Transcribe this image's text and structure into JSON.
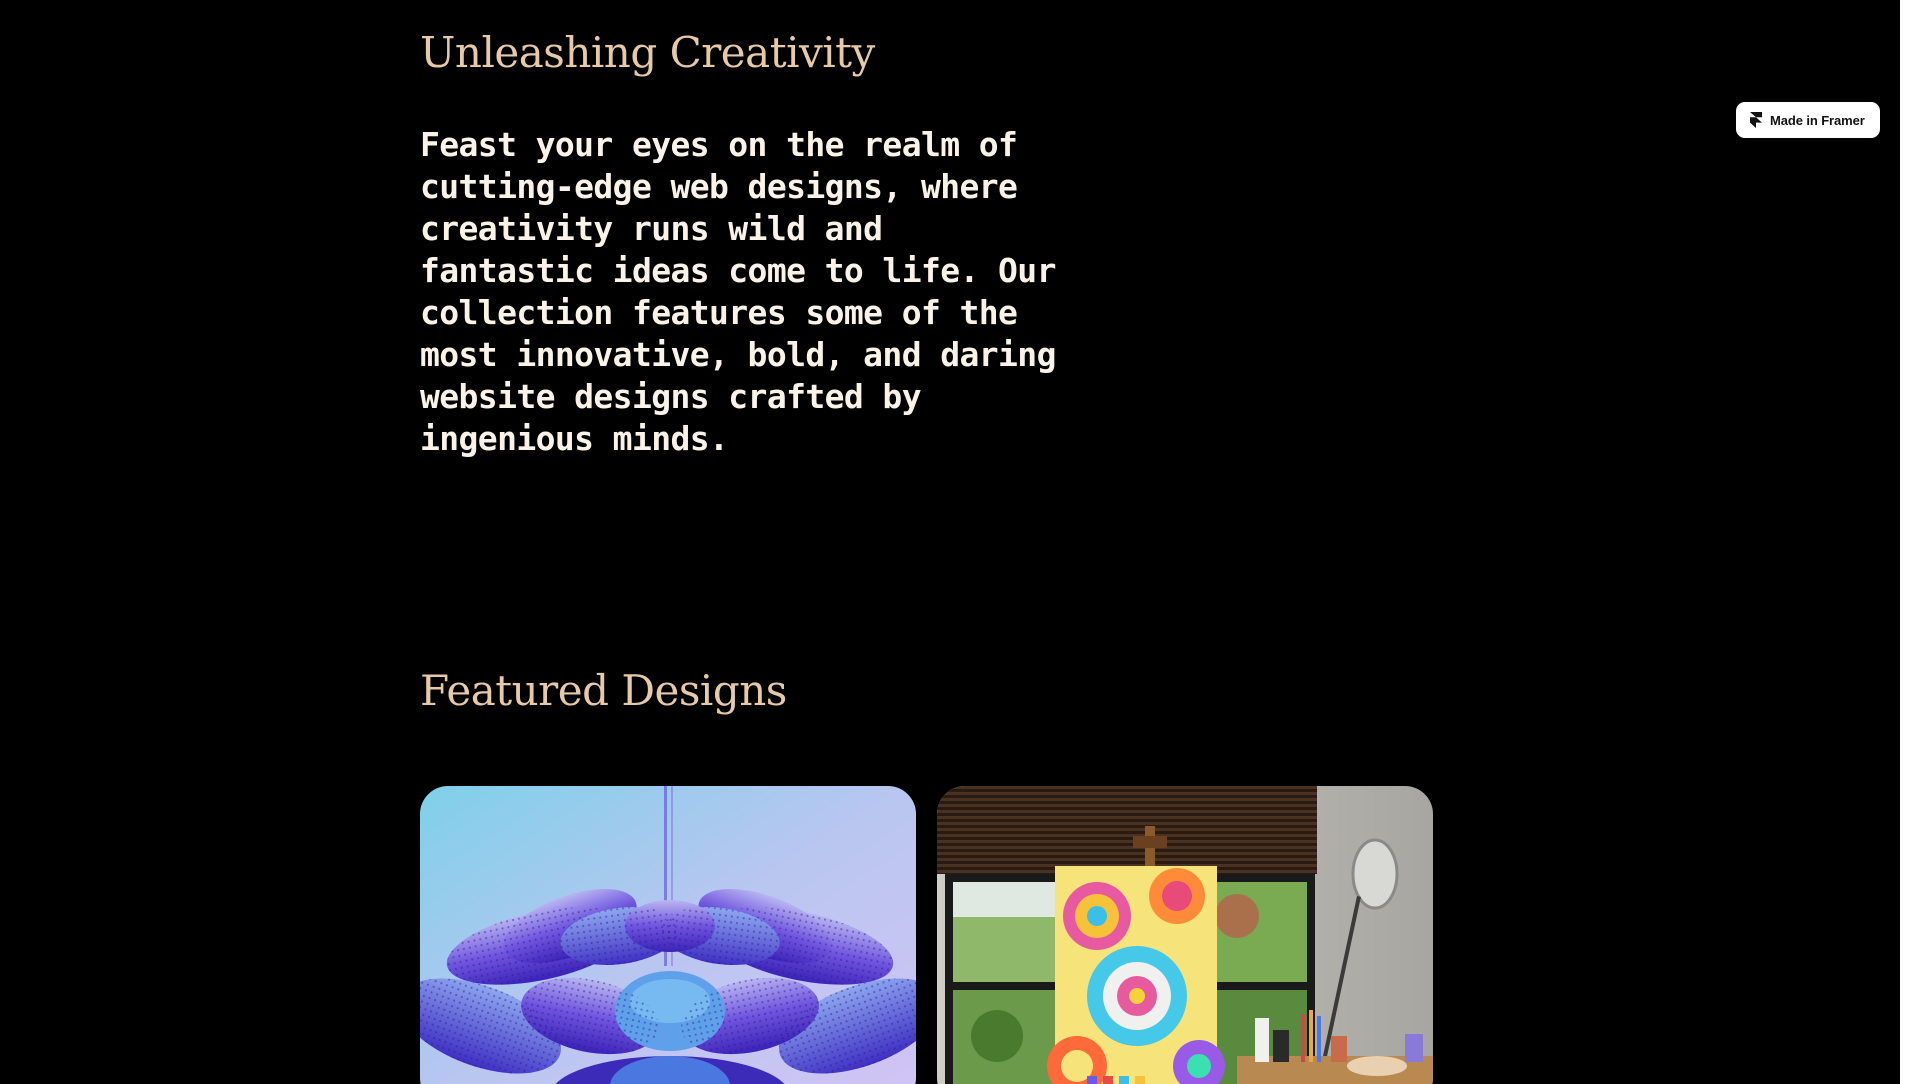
{
  "sections": {
    "about": {
      "heading": "Unleashing Creativity",
      "body": "Feast your eyes on the realm of cutting-edge web designs, where creativity runs wild and fantastic ideas come to life. Our collection features some of the most innovative, bold, and daring website designs crafted by ingenious minds."
    },
    "featured": {
      "heading": "Featured Designs",
      "cards": [
        {
          "image": "purple-3d-flower-sculpture"
        },
        {
          "image": "colorful-swirl-painting-on-easel"
        }
      ]
    }
  },
  "badge": {
    "label": "Made in Framer",
    "icon": "framer-logo-icon"
  },
  "colors": {
    "background": "#000000",
    "heading": "#e6c9a8",
    "body_text": "#fbf3e8",
    "badge_bg": "#ffffff"
  }
}
